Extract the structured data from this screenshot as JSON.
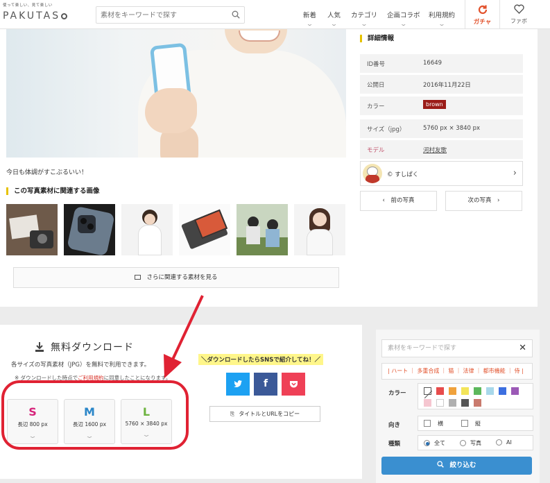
{
  "header": {
    "logo_tagline": "使って楽しい、見て楽しい",
    "logo_name": "PAKUTAS",
    "search_placeholder": "素材をキーワードで探す",
    "nav": [
      {
        "label": "新着"
      },
      {
        "label": "人気"
      },
      {
        "label": "カテゴリ"
      },
      {
        "label": "企画コラボ"
      },
      {
        "label": "利用規約"
      }
    ],
    "gacha_label": "ガチャ",
    "favorite_label": "ファボ",
    "gacha_color": "#e2512b"
  },
  "main": {
    "caption": "今日も体調がすこぶるいい！",
    "related_heading": "この写真素材に関連する画像",
    "more_button": "さらに関連する素材を見る"
  },
  "details": {
    "heading": "詳細情報",
    "rows": [
      {
        "key": "ID番号",
        "value": "16649"
      },
      {
        "key": "公開日",
        "value": "2016年11月22日"
      },
      {
        "key": "カラー",
        "value": "brown"
      },
      {
        "key": "サイズ（jpg）",
        "value": "5760 px × 3840 px"
      },
      {
        "key": "モデル",
        "value": "河村友歌"
      }
    ],
    "author": "© すしぱく",
    "prev": "‹　前の写真",
    "next": "次の写真　›",
    "brown_color": "#9b1c18"
  },
  "download": {
    "title": "無料ダウンロード",
    "description": "各サイズの写真素材（JPG）を無料で利用できます。",
    "note_prefix": "※ ダウンロードした時点で",
    "note_link": "ご利用規約",
    "note_suffix": "に同意したことになります。",
    "sizes": [
      {
        "letter": "S",
        "dims": "長辺 800 px",
        "color": "#d6237a"
      },
      {
        "letter": "M",
        "dims": "長辺 1600 px",
        "color": "#2a86c8"
      },
      {
        "letter": "L",
        "dims": "5760 × 3840 px",
        "color": "#6db33f"
      }
    ],
    "sns_label": "＼ダウンロードしたらSNSで紹介してね！／",
    "copy_button": "タイトルとURLをコピー",
    "sns": [
      {
        "name": "twitter",
        "color": "#1da1f2"
      },
      {
        "name": "facebook",
        "color": "#3b5998"
      },
      {
        "name": "pocket",
        "color": "#ef4056"
      }
    ]
  },
  "filter": {
    "search_placeholder": "素材をキーワードで探す",
    "tags": "| ハート ｜ 多重合成 ｜ 猫 ｜ 法律 ｜ 都市機能 ｜ 侍 |",
    "color_label": "カラー",
    "orientation_label": "向き",
    "orientation_options": [
      "横",
      "縦"
    ],
    "type_label": "種類",
    "type_options": [
      "全て",
      "写真",
      "AI"
    ],
    "submit": "絞り込む",
    "swatches": [
      "#e74c4c",
      "#f0a23c",
      "#f3e55a",
      "#5cb85c",
      "#a8d8ea",
      "#3c6fe0",
      "#9b59b6",
      "#f5c6d0",
      "#ffffff",
      "#b0b0b0",
      "#555555",
      "#c97a6d"
    ]
  }
}
